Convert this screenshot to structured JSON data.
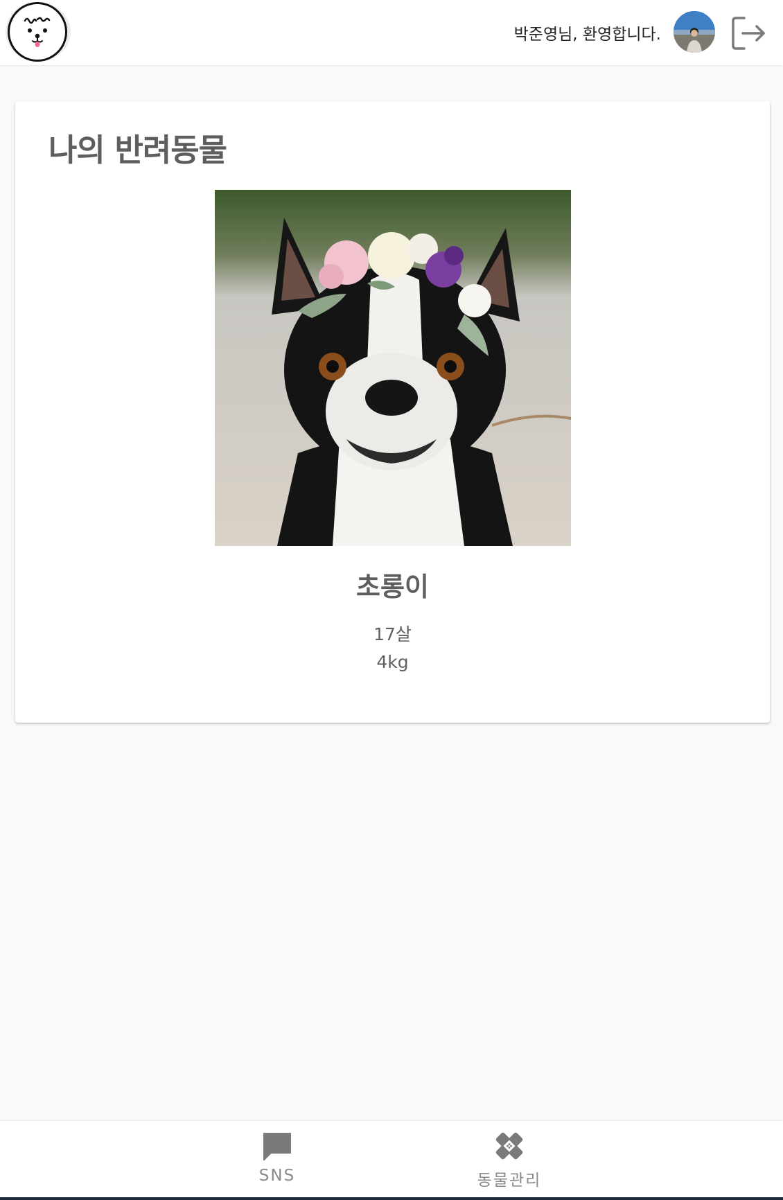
{
  "header": {
    "welcome_text": "박준영님, 환영합니다.",
    "logo_icon": "dog-face-logo-icon",
    "avatar_icon": "user-avatar-icon",
    "logout_icon": "logout-icon"
  },
  "card": {
    "title": "나의 반려동물",
    "pet": {
      "photo_icon": "dog-photo",
      "name": "초롱이",
      "age": "17살",
      "weight": "4kg"
    }
  },
  "bottom_nav": {
    "items": [
      {
        "label": "SNS",
        "icon": "chat-bubble-icon"
      },
      {
        "label": "동물관리",
        "icon": "bandage-icon"
      }
    ]
  },
  "colors": {
    "background": "#f9f9f9",
    "card": "#ffffff",
    "text": "#5f5f5f",
    "nav_icon": "#7a7a7a"
  }
}
